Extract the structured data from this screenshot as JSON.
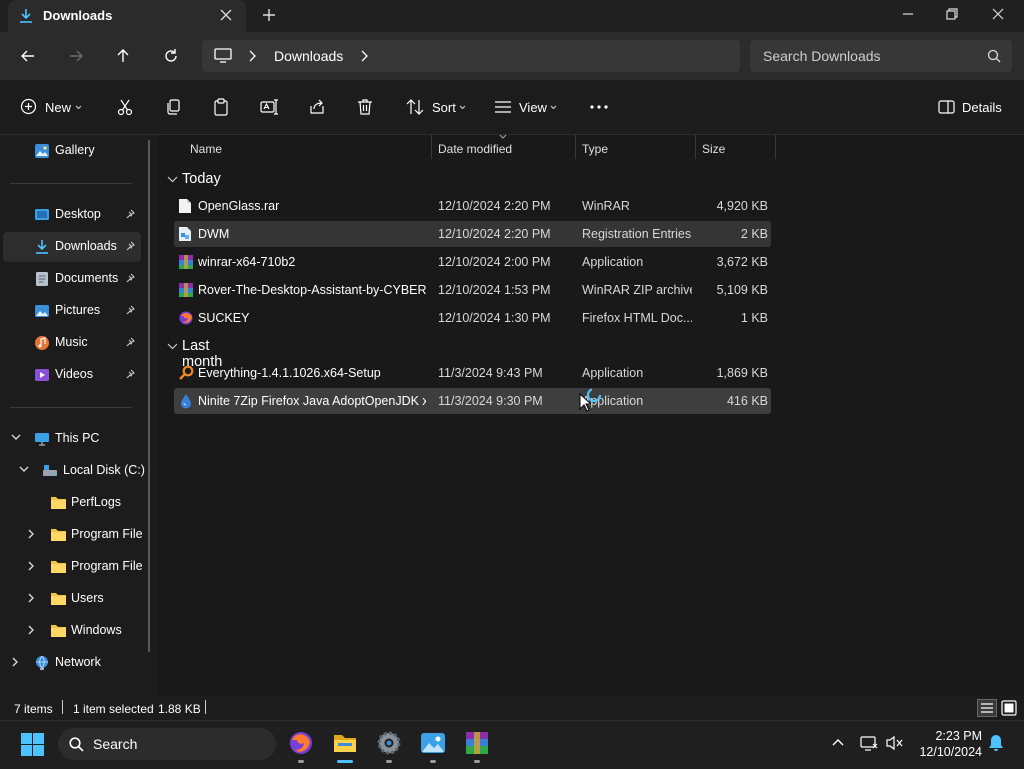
{
  "window": {
    "tab_title": "Downloads",
    "address": "Downloads",
    "search_placeholder": "Search Downloads"
  },
  "toolbar": {
    "new_label": "New",
    "sort_label": "Sort",
    "view_label": "View",
    "details_label": "Details"
  },
  "sidebar": {
    "gallery": "Gallery",
    "desktop": "Desktop",
    "downloads": "Downloads",
    "documents": "Documents",
    "pictures": "Pictures",
    "music": "Music",
    "videos": "Videos",
    "this_pc": "This PC",
    "local_disk": "Local Disk (C:)",
    "perflogs": "PerfLogs",
    "program_files_1": "Program File",
    "program_files_2": "Program File",
    "users": "Users",
    "windows": "Windows",
    "network": "Network"
  },
  "columns": {
    "name": "Name",
    "date": "Date modified",
    "type": "Type",
    "size": "Size"
  },
  "groups": {
    "today": "Today",
    "last_month": "Last month"
  },
  "files": [
    {
      "name": "OpenGlass.rar",
      "date": "12/10/2024 2:20 PM",
      "type": "WinRAR",
      "size": "4,920 KB",
      "icon": "document-icon"
    },
    {
      "name": "DWM",
      "date": "12/10/2024 2:20 PM",
      "type": "Registration Entries",
      "size": "2 KB",
      "icon": "registry-icon"
    },
    {
      "name": "winrar-x64-710b2",
      "date": "12/10/2024 2:00 PM",
      "type": "Application",
      "size": "3,672 KB",
      "icon": "winrar-icon"
    },
    {
      "name": "Rover-The-Desktop-Assistant-by-CYBER...",
      "date": "12/10/2024 1:53 PM",
      "type": "WinRAR ZIP archive",
      "size": "5,109 KB",
      "icon": "winrar-archive-icon"
    },
    {
      "name": "SUCKEY",
      "date": "12/10/2024 1:30 PM",
      "type": "Firefox HTML Doc...",
      "size": "1 KB",
      "icon": "firefox-doc-icon"
    },
    {
      "name": "Everything-1.4.1.1026.x64-Setup",
      "date": "11/3/2024 9:43 PM",
      "type": "Application",
      "size": "1,869 KB",
      "icon": "magnifier-app-icon"
    },
    {
      "name": "Ninite 7Zip Firefox Java AdoptOpenJDK x...",
      "date": "11/3/2024 9:30 PM",
      "type": "Application",
      "size": "416 KB",
      "icon": "ninite-icon"
    }
  ],
  "status": {
    "item_count": "7 items",
    "selection": "1 item selected",
    "selection_size": "1.88 KB"
  },
  "taskbar": {
    "search_label": "Search",
    "time": "2:23 PM",
    "date": "12/10/2024"
  },
  "colors": {
    "accent": "#4cc2ff",
    "folder": "#f4c542",
    "background": "#191919"
  }
}
